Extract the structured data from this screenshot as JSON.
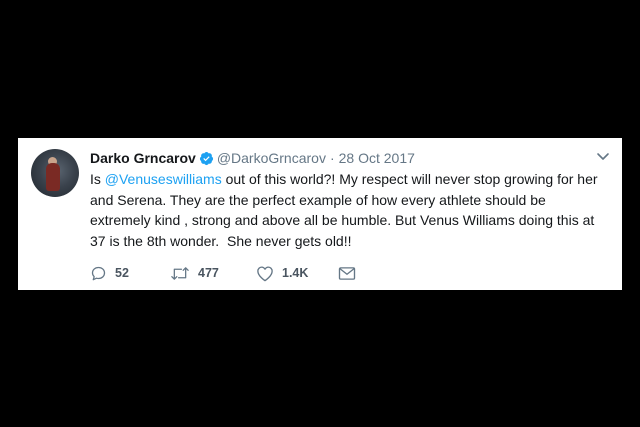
{
  "tweet": {
    "display_name": "Darko Grncarov",
    "verified_icon": "verified-badge-icon",
    "handle": "@DarkoGrncarov",
    "separator": "·",
    "date": "28 Oct 2017",
    "text_prefix": "Is ",
    "mention": "@Venuseswilliams",
    "text_body": " out of this world?! My respect will never stop growing for her and Serena. They are the perfect example of how every athlete should be extremely kind , strong and above all be humble. But Venus Williams doing this at 37 is the 8th wonder.  She never gets old!!",
    "actions": {
      "replies": "52",
      "retweets": "477",
      "likes": "1.4K"
    }
  },
  "colors": {
    "mention": "#1da1f2",
    "verified": "#1da1f2",
    "text": "#14171a",
    "muted": "#657786",
    "background": "#000000",
    "card": "#ffffff"
  }
}
